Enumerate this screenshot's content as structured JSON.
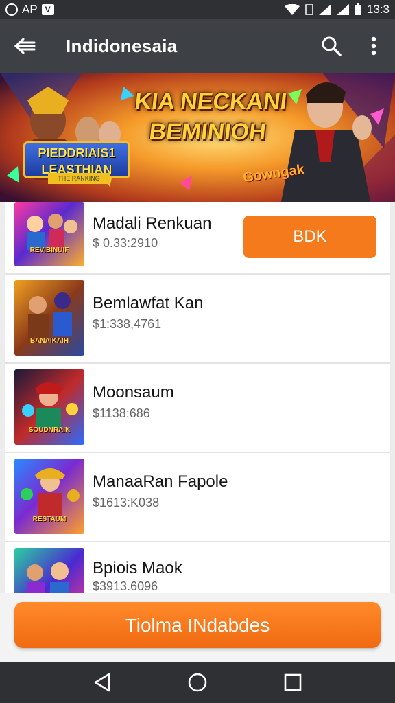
{
  "status_bar": {
    "carrier": "AP",
    "time": "13:3"
  },
  "app_bar": {
    "title": "Indidonesaia",
    "back_icon": "arrow-left-icon",
    "search_icon": "search-icon",
    "menu_icon": "more-vert-icon"
  },
  "banner": {
    "headline_1": "KIA NECKANI",
    "headline_2": "BEMINIOH",
    "logo_text": "PIEDDRIAIS1 LEASTHIAN",
    "logo_subtext": "THE RANKING",
    "badge_text": "Gowngak"
  },
  "items": [
    {
      "name": "Madali Renkuan",
      "price": "$ 0.33:2910",
      "button_label": "BDK",
      "thumb_caption": "REVIBINUIF"
    },
    {
      "name": "Bemlawfat Kan",
      "price": "$1:338,4761",
      "thumb_caption": "BANAIKAIH"
    },
    {
      "name": "Moonsaum",
      "price": "$1138:686",
      "thumb_caption": "SOUDNRAIK"
    },
    {
      "name": "ManaaRan Fapole",
      "price": "$1613:K038",
      "thumb_caption": "RESTAUM"
    },
    {
      "name": "Bpiois Maok",
      "price": "$3913.6096",
      "thumb_caption": ""
    }
  ],
  "bottom_button": {
    "label": "Tiolma INdabdes"
  },
  "nav": {
    "back_icon": "nav-back-triangle-icon",
    "home_icon": "nav-home-circle-icon",
    "recents_icon": "nav-recents-square-icon"
  },
  "colors": {
    "accent": "#f47a1c",
    "app_bar": "#3d4045",
    "status_bar": "#2e3034"
  }
}
